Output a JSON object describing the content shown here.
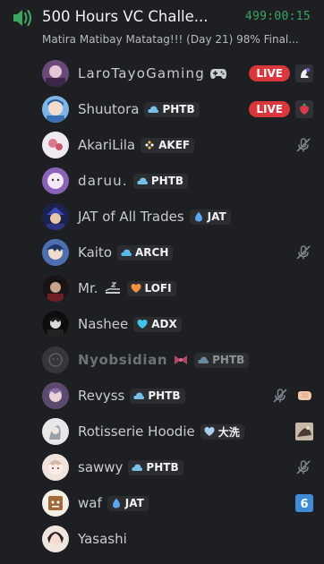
{
  "header": {
    "title": "500 Hours VC Challe...",
    "timer": "499:00:15",
    "status": "Matira Matibay Matatag!!! (Day 21) 98% Final..."
  },
  "live_label": "LIVE",
  "members": [
    {
      "name": "LaroTayoGaming",
      "extra": "controller",
      "live": true,
      "right": "stream-preview"
    },
    {
      "name": "Shuutora",
      "tag": "PHTB",
      "tag_icon": "blue-cloud",
      "live": true,
      "right": "stream-preview"
    },
    {
      "name": "AkariLila",
      "tag": "AKEF",
      "tag_icon": "gold-diamonds",
      "right": "muted"
    },
    {
      "name": "daruu.",
      "tag": "PHTB",
      "tag_icon": "blue-cloud"
    },
    {
      "name": "JAT of All Trades",
      "tag": "JAT",
      "tag_icon": "blue-drop"
    },
    {
      "name": "Kaito",
      "tag": "ARCH",
      "tag_icon": "blue-cloud",
      "right": "muted"
    },
    {
      "name": "Mr.",
      "extra": "sleeping",
      "tag": "LOFI",
      "tag_icon": "orange-heart"
    },
    {
      "name": "Nashee",
      "tag": "ADX",
      "tag_icon": "cyan-heart"
    },
    {
      "name": "Nyobsidian",
      "extra": "pink-bow",
      "tag": "PHTB",
      "tag_icon": "blue-cloud",
      "dim": true
    },
    {
      "name": "Revyss",
      "tag": "PHTB",
      "tag_icon": "blue-cloud",
      "right": "muted-fist"
    },
    {
      "name": "Rotisserie Hoodie",
      "tag": "大洗",
      "tag_icon": "light-heart",
      "right": "activity-image"
    },
    {
      "name": "sawwy",
      "tag": "PHTB",
      "tag_icon": "blue-cloud",
      "right": "muted"
    },
    {
      "name": "waf",
      "tag": "JAT",
      "tag_icon": "blue-drop",
      "right": "number-six"
    },
    {
      "name": "Yasashi"
    }
  ],
  "colors": {
    "background": "#1e1f22",
    "timer": "#3ba55d",
    "live": "#da373c",
    "voice_icon": "#3ba55d"
  }
}
